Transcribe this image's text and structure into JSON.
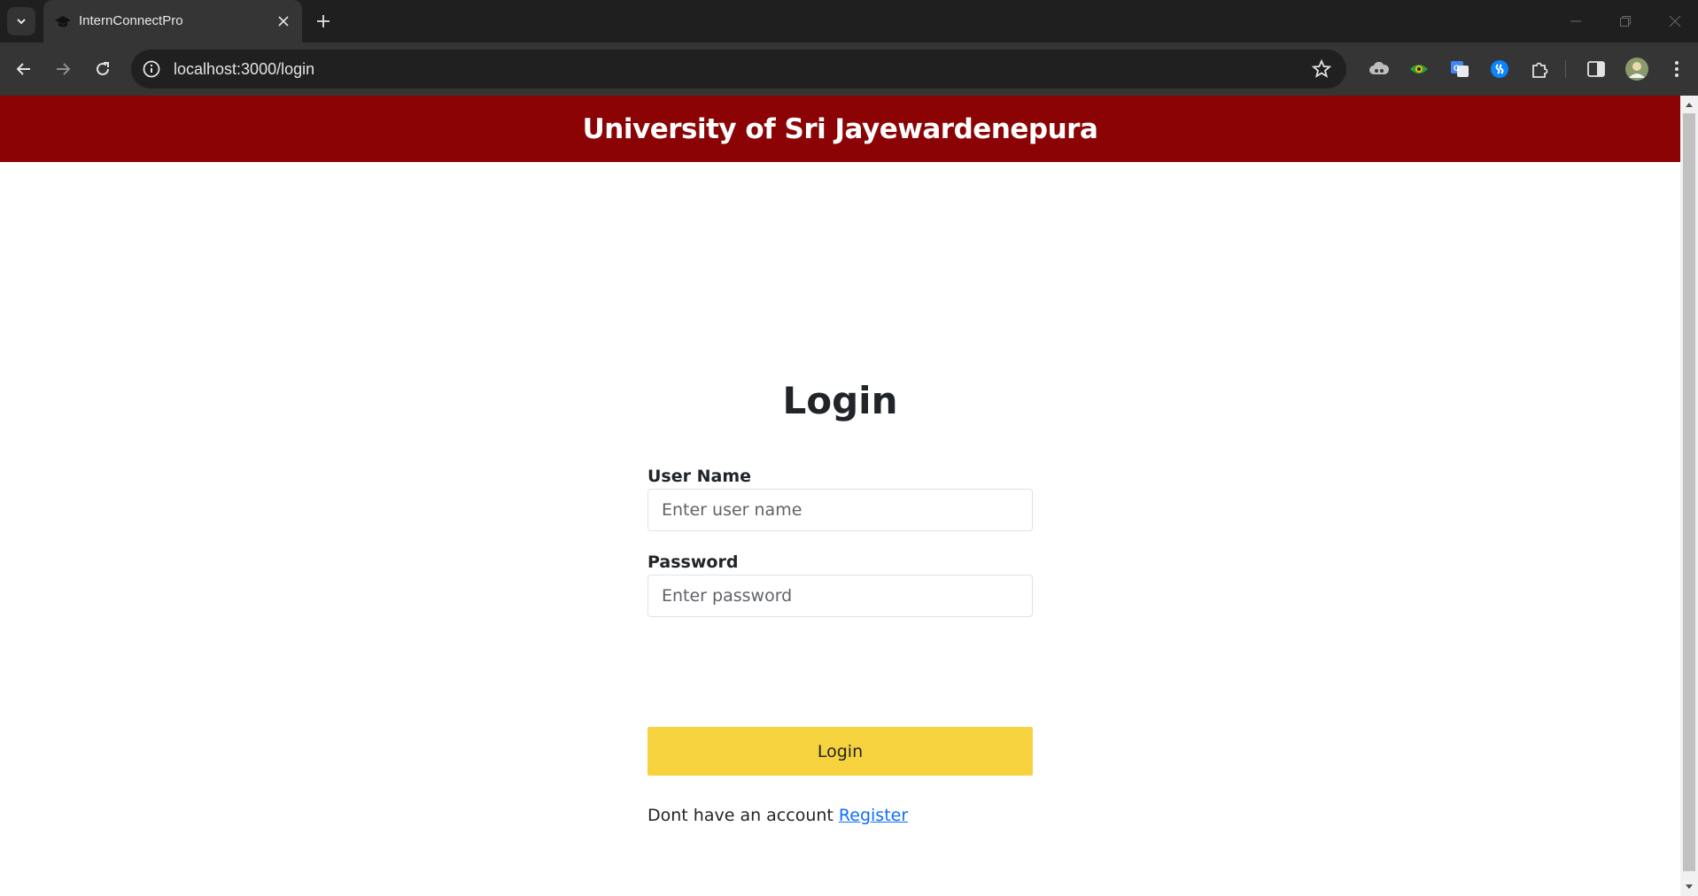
{
  "browser": {
    "tab_title": "InternConnectPro",
    "url": "localhost:3000/login"
  },
  "icons": {
    "tab_list": "chevron-down-icon",
    "favicon": "graduation-cap-icon",
    "tab_close": "close-icon",
    "new_tab": "plus-icon",
    "back": "arrow-left-icon",
    "forward": "arrow-right-icon",
    "reload": "reload-icon",
    "site_info": "info-icon",
    "bookmark": "star-icon",
    "extensions": [
      "cloud-extension-icon",
      "eye-extension-icon",
      "translate-extension-icon",
      "shazam-extension-icon",
      "puzzle-icon"
    ],
    "side_panel": "side-panel-icon",
    "profile": "avatar",
    "menu": "kebab-menu-icon"
  },
  "colors": {
    "header_bg": "#8b0304",
    "button_bg": "#f6d33e",
    "link": "#0d6efd"
  },
  "header": {
    "title": "University of Sri Jayewardenepura"
  },
  "login": {
    "heading": "Login",
    "username_label": "User Name",
    "username_placeholder": "Enter user name",
    "username_value": "",
    "password_label": "Password",
    "password_placeholder": "Enter password",
    "password_value": "",
    "submit_label": "Login",
    "register_prompt": "Dont have an account",
    "register_link": "Register"
  }
}
